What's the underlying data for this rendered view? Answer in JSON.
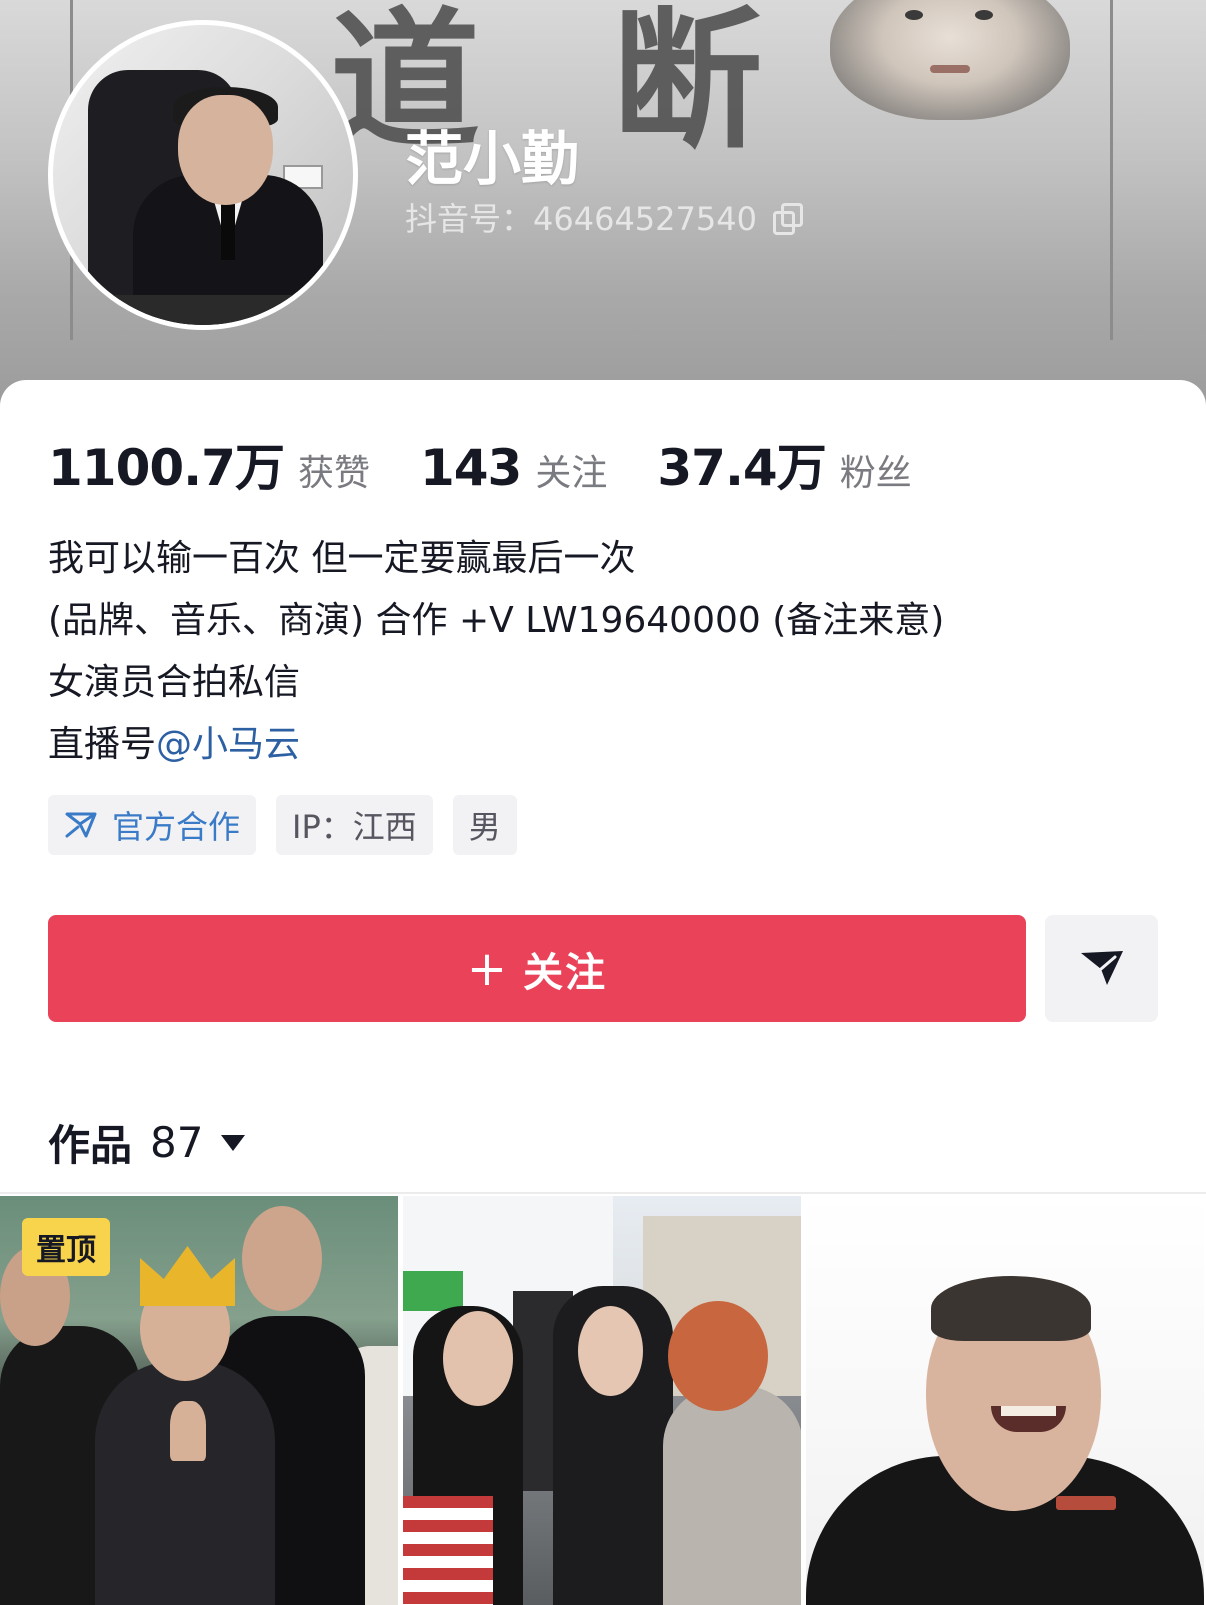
{
  "profile": {
    "name": "范小勤",
    "douyin_id": "抖音号：46464527540",
    "avatar_icon": "avatar-photo"
  },
  "stats": [
    {
      "value": "1100.7万",
      "label": "获赞"
    },
    {
      "value": "143",
      "label": "关注"
    },
    {
      "value": "37.4万",
      "label": "粉丝"
    }
  ],
  "bio": {
    "line1": "我可以输一百次 但一定要赢最后一次",
    "line2": "(品牌、音乐、商演) 合作 +V   LW19640000 (备注来意)",
    "line3": "女演员合拍私信",
    "line4_prefix": "直播号",
    "line4_mention": "@小马云"
  },
  "tags": {
    "official": "官方合作",
    "ip": "IP：江西",
    "gender": "男"
  },
  "actions": {
    "follow_plus": "+",
    "follow_label": "关注",
    "share_icon": "send-icon"
  },
  "works": {
    "label": "作品",
    "count": "87"
  },
  "videos": [
    {
      "badge": "置顶"
    },
    {},
    {}
  ],
  "colors": {
    "follow_button": "#ea4359",
    "mention": "#2d5fa3",
    "pin_badge": "#f7d44c",
    "official_tag": "#3a7bc8"
  }
}
